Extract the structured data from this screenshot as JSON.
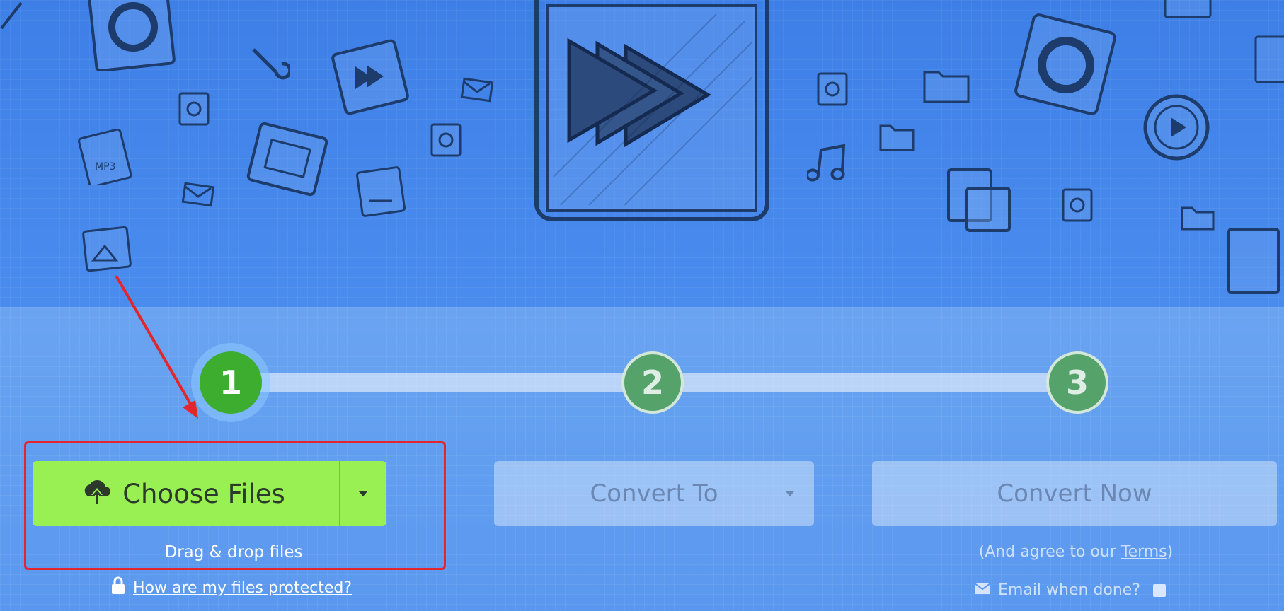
{
  "steps": [
    {
      "number": "1",
      "state": "active"
    },
    {
      "number": "2",
      "state": "idle"
    },
    {
      "number": "3",
      "state": "idle"
    }
  ],
  "choose_files": {
    "label": "Choose Files",
    "icon": "cloud-upload-icon",
    "dropdown_icon": "caret-down-icon",
    "drag_drop_text": "Drag & drop files",
    "protect_link": "How are my files protected?",
    "protect_icon": "lock-icon"
  },
  "convert_to": {
    "label": "Convert To",
    "dropdown_icon": "caret-down-icon"
  },
  "convert_now": {
    "label": "Convert Now",
    "agree_prefix": "(And agree to our ",
    "agree_terms": "Terms",
    "agree_suffix": ")",
    "email_label": "Email when done?",
    "email_icon": "envelope-icon",
    "email_checked": false
  },
  "colors": {
    "accent_green": "#98f052",
    "step_active": "#3cad2e",
    "highlight_red": "#e3262b",
    "background_blue": "#4a8cee"
  }
}
